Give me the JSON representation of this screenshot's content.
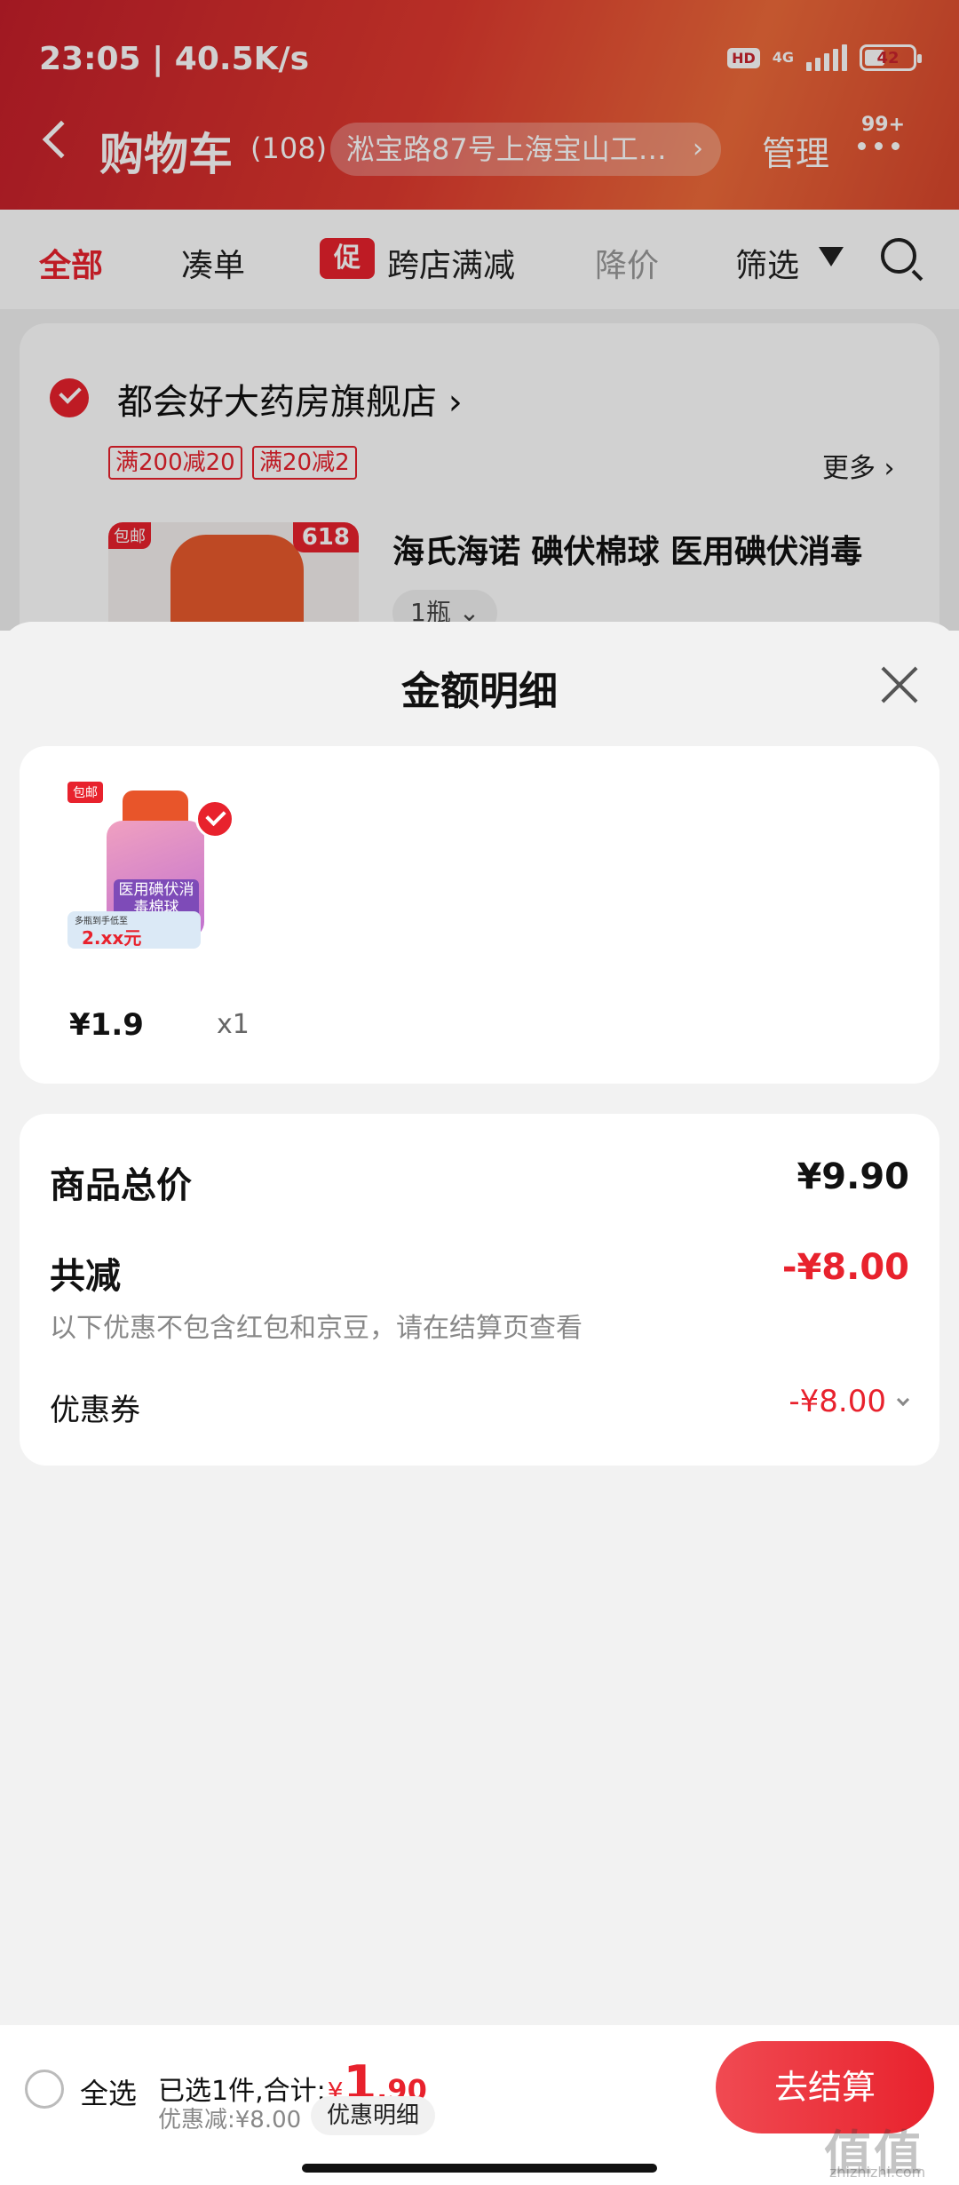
{
  "status_bar": {
    "time": "23:05 | 40.5K/s",
    "hd": "HD",
    "network": "4G",
    "battery": "42",
    "battery_level": 0.42
  },
  "header": {
    "title": "购物车",
    "count": "(108)",
    "address": "淞宝路87号上海宝山工…",
    "manage_label": "管理",
    "message_badge": "99+"
  },
  "filter_tabs": {
    "all": "全部",
    "bundle": "凑单",
    "promo_badge": "促",
    "cross_store": "跨店满减",
    "price_drop": "降价",
    "filter": "筛选"
  },
  "store": {
    "name": "都会好大药房旗舰店",
    "chevron": "›",
    "coupons": [
      "满200减20",
      "满20减2"
    ],
    "more": "更多 ›",
    "product_title": "海氏海诺 碘伏棉球 医用碘伏消毒",
    "product_tag_ship": "包邮",
    "product_tag_618": "618",
    "spec": "1瓶 ⌄"
  },
  "sheet": {
    "title": "金额明细",
    "item": {
      "tag_ship": "包邮",
      "label": "医用碘伏消毒棉球",
      "promo_hint": "多瓶到手低至",
      "promo_value": "2.xx元",
      "price": "¥1.9",
      "qty": "x1"
    },
    "summary": {
      "total_label": "商品总价",
      "total_value": "¥9.90",
      "reduce_label": "共减",
      "reduce_value": "-¥8.00",
      "note": "以下优惠不包含红包和京豆，请在结算页查看",
      "coupon_label": "优惠券",
      "coupon_value": "-¥8.00"
    }
  },
  "checkout": {
    "select_all": "全选",
    "summary_prefix": "已选1件,合计:",
    "currency": "¥",
    "total_int": "1",
    "total_dec": ".90",
    "discount": "优惠减:¥8.00",
    "detail_label": "优惠明细",
    "button": "去结算"
  },
  "watermark": {
    "main": "值值值",
    "sub": "zhizhizhi.com"
  },
  "colors": {
    "accent": "#e8222d",
    "header": "#d8302c"
  }
}
